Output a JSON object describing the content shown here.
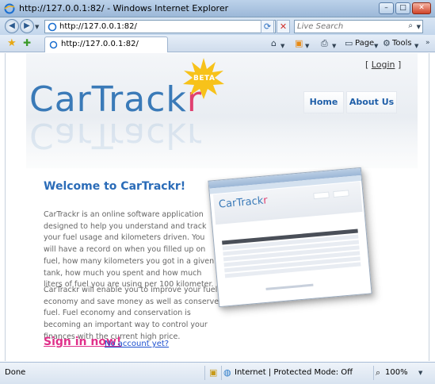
{
  "window": {
    "title": "http://127.0.0.1:82/ - Windows Internet Explorer",
    "minimize": "–",
    "maximize": "□",
    "close": "✕"
  },
  "address": {
    "url": "http://127.0.0.1:82/",
    "refresh_icon": "⟳",
    "stop_icon": "✕",
    "search_placeholder": "Live Search",
    "back_icon": "◀",
    "forward_icon": "▶"
  },
  "tabbar": {
    "tab_label": "http://127.0.0.1:82/",
    "home_icon": "⌂",
    "feeds_icon": "▣",
    "print_icon": "⎙",
    "page_label": "Page",
    "tools_label": "Tools"
  },
  "site": {
    "logo_main": "CarTrack",
    "logo_end": "r",
    "beta": "BETA",
    "login_open": "[ ",
    "login_link": "Login",
    "login_close": " ]",
    "nav": [
      {
        "label": "Home"
      },
      {
        "label": "About Us"
      }
    ],
    "welcome": "Welcome to CarTrackr!",
    "para1": "CarTrackr is an online software application designed to help you understand and track your fuel usage and kilometers driven. You will have a record on when you filled up on fuel, how many kilometers you got in a given tank, how much you spent and how much liters of fuel you are using per 100 kilometer.",
    "para2": "CarTrackr will enable you to improve your fuel economy and save money as well as conserve fuel. Fuel economy and conservation is becoming an important way to control your finances with the current high price.",
    "signin": "Sign in now!",
    "no_account": "No account yet?"
  },
  "status": {
    "done": "Done",
    "zone": "Internet | Protected Mode: Off",
    "zoom": "100%"
  },
  "colors": {
    "accent_blue": "#2b6cb8",
    "logo_blue": "#3a7ab8",
    "logo_pink": "#e04070",
    "signin_pink": "#e0308a",
    "beta_yellow": "#f7c21a"
  },
  "icons": [
    "ie-logo-icon",
    "back-arrow-icon",
    "forward-arrow-icon",
    "refresh-icon",
    "stop-icon",
    "search-icon",
    "favorites-star-icon",
    "add-favorites-icon",
    "home-icon",
    "feeds-icon",
    "print-icon",
    "page-icon",
    "tools-gear-icon",
    "security-icon",
    "globe-icon",
    "zoom-icon"
  ]
}
